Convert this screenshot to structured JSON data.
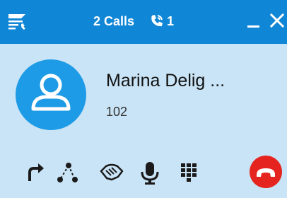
{
  "titlebar": {
    "calls_label": "2 Calls",
    "phone_count": "1",
    "icons": [
      "call-list-icon",
      "phone-lines-icon",
      "minimize-icon",
      "close-icon"
    ]
  },
  "contact": {
    "name": "Marina Delig ...",
    "extension": "102",
    "avatar_icon": "person-icon"
  },
  "toolbar": {
    "icons": [
      "transfer-icon",
      "conference-icon",
      "handshake-icon",
      "microphone-icon",
      "dialpad-icon",
      "hangup-icon"
    ]
  },
  "colors": {
    "titlebar_bg": "#0f86d6",
    "window_bg": "#c9e4f6",
    "avatar_bg": "#1e9be6",
    "hangup_bg": "#e52420"
  }
}
